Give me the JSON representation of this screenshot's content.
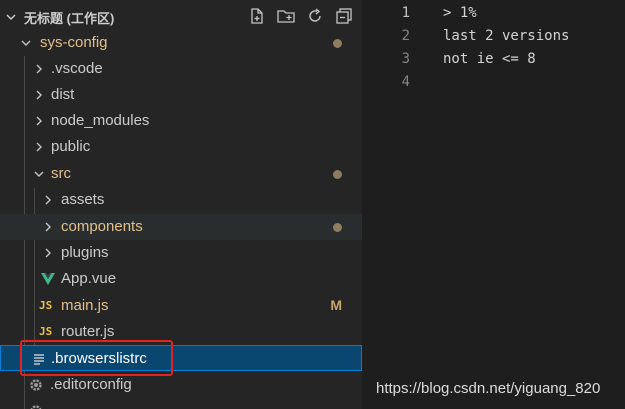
{
  "workspace": {
    "title": "无标题 (工作区)",
    "icons": [
      "new-file-icon",
      "new-folder-icon",
      "refresh-icon",
      "collapse-all-icon"
    ]
  },
  "tree": {
    "root": {
      "label": "sys-config",
      "status": "modified-dot"
    },
    "items": [
      {
        "label": ".vscode",
        "kind": "folder"
      },
      {
        "label": "dist",
        "kind": "folder"
      },
      {
        "label": "node_modules",
        "kind": "folder"
      },
      {
        "label": "public",
        "kind": "folder"
      },
      {
        "label": "src",
        "kind": "folder-open"
      },
      {
        "label": "assets",
        "kind": "folder"
      },
      {
        "label": "components",
        "kind": "folder"
      },
      {
        "label": "plugins",
        "kind": "folder"
      },
      {
        "label": "App.vue",
        "kind": "vue"
      },
      {
        "label": "main.js",
        "kind": "js",
        "badge": "M"
      },
      {
        "label": "router.js",
        "kind": "js"
      },
      {
        "label": ".browserslistrc",
        "kind": "text"
      },
      {
        "label": ".editorconfig",
        "kind": "config"
      }
    ],
    "js_icon_text": "JS"
  },
  "editor": {
    "lines": [
      {
        "num": "1",
        "text": "> 1%"
      },
      {
        "num": "2",
        "text": "last 2 versions"
      },
      {
        "num": "3",
        "text": "not ie <= 8"
      },
      {
        "num": "4",
        "text": ""
      }
    ]
  },
  "watermark": "https://blog.csdn.net/yiguang_820",
  "colors": {
    "sidebar_bg": "#252526",
    "editor_bg": "#1e1e1e",
    "selection_bg": "#094771",
    "modified_text": "#e2c08d",
    "highlight_border": "#e02424"
  }
}
